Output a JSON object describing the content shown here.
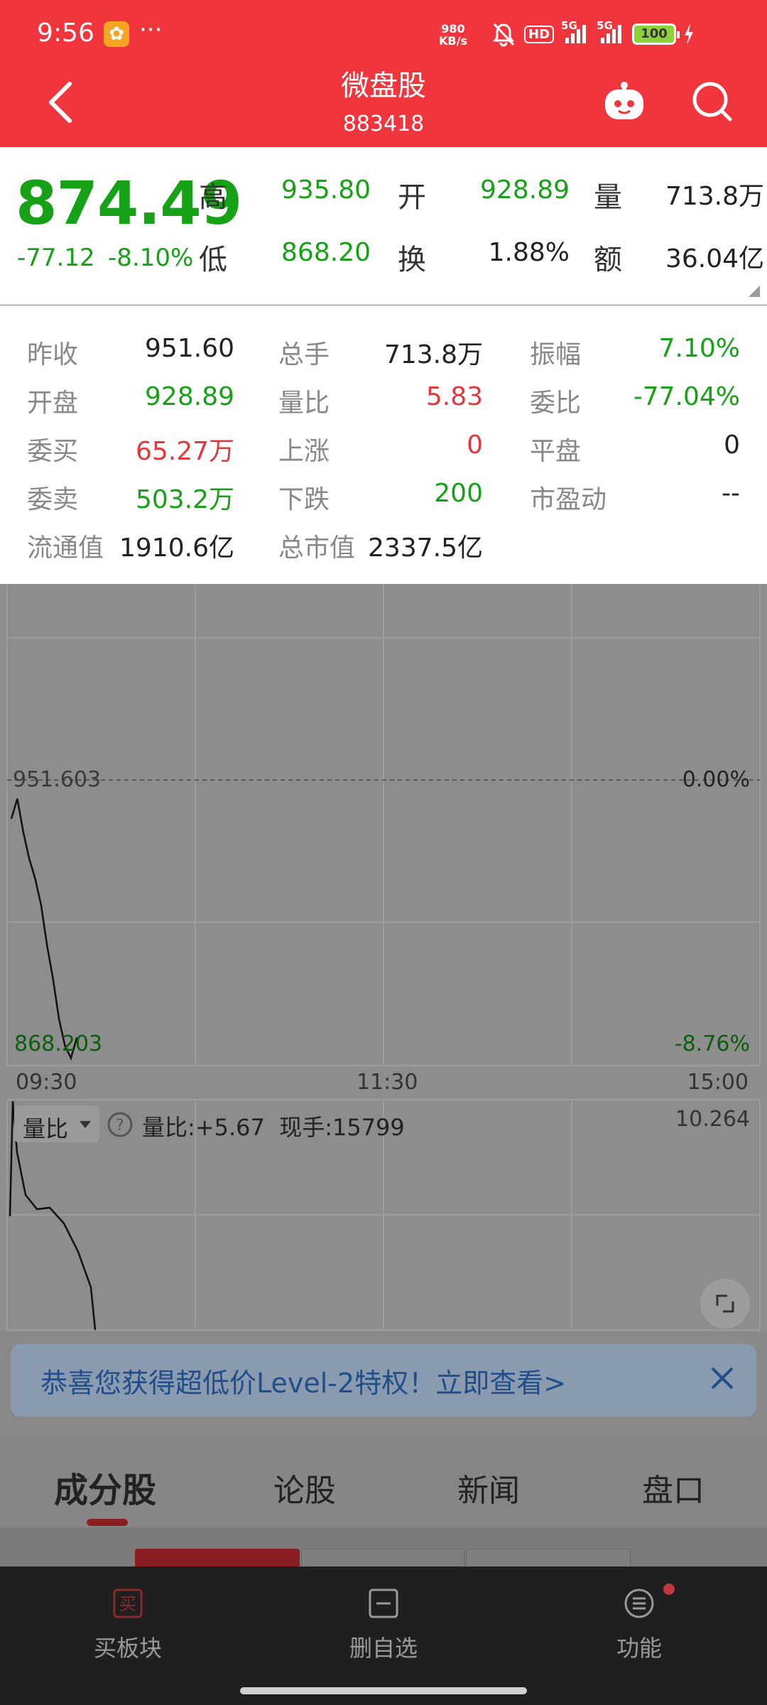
{
  "status_bar": {
    "time": "9:56",
    "dots": "···",
    "net_speed_value": "980",
    "net_speed_unit": "KB/s",
    "battery": "100",
    "network_1": "5G",
    "network_2": "5G"
  },
  "header": {
    "title": "微盘股",
    "code": "883418"
  },
  "quote": {
    "price": "874.49",
    "change": "-77.12",
    "change_pct": "-8.10%",
    "high_label": "高",
    "high": "935.80",
    "low_label": "低",
    "low": "868.20",
    "open_label": "开",
    "open": "928.89",
    "turnover_label": "换",
    "turnover": "1.88%",
    "volume_label": "量",
    "volume": "713.8万",
    "amount_label": "额",
    "amount": "36.04亿"
  },
  "stats": [
    [
      {
        "label": "昨收",
        "value": "951.60",
        "color": "dark"
      },
      {
        "label": "总手",
        "value": "713.8万",
        "color": "dark"
      },
      {
        "label": "振幅",
        "value": "7.10%",
        "color": "green"
      }
    ],
    [
      {
        "label": "开盘",
        "value": "928.89",
        "color": "green"
      },
      {
        "label": "量比",
        "value": "5.83",
        "color": "red"
      },
      {
        "label": "委比",
        "value": "-77.04%",
        "color": "green"
      }
    ],
    [
      {
        "label": "委买",
        "value": "65.27万",
        "color": "red"
      },
      {
        "label": "上涨",
        "value": "0",
        "color": "red"
      },
      {
        "label": "平盘",
        "value": "0",
        "color": "dark"
      }
    ],
    [
      {
        "label": "委卖",
        "value": "503.2万",
        "color": "green"
      },
      {
        "label": "下跌",
        "value": "200",
        "color": "green"
      },
      {
        "label": "市盈动",
        "value": "--",
        "color": "dark"
      }
    ],
    [
      {
        "label": "流通值",
        "value": "1910.6亿",
        "color": "dark"
      },
      {
        "label": "总市值",
        "value": "2337.5亿",
        "color": "dark"
      }
    ]
  ],
  "chart": {
    "prev_close_label": "951.603",
    "right_zero": "0.00%",
    "low_label": "868.203",
    "right_low": "-8.76%",
    "time_start": "09:30",
    "time_mid": "11:30",
    "time_end": "15:00",
    "vol_indicator": "量比",
    "vol_desc": "量比:+5.67  现手:15799",
    "vol_max": "10.264"
  },
  "chart_data": {
    "type": "line",
    "title": "",
    "x": [
      "09:30",
      "09:32",
      "09:34",
      "09:36",
      "09:38",
      "09:40",
      "09:42",
      "09:44",
      "09:46",
      "09:48",
      "09:50",
      "09:52"
    ],
    "series": [
      {
        "values": [
          940.0,
          946.0,
          936.0,
          928.0,
          922.0,
          914.0,
          902.0,
          892.0,
          880.0,
          872.0,
          868.3,
          874.5
        ]
      }
    ],
    "ylim": [
      868.2,
      951.6
    ],
    "prev_close": 951.603,
    "grid": true
  },
  "promo": {
    "text": "恭喜您获得超低价Level-2特权！立即查看>"
  },
  "tabs": [
    "成分股",
    "论股",
    "新闻",
    "盘口"
  ],
  "bottom_nav": [
    {
      "label": "买板块",
      "icon": "buy-icon"
    },
    {
      "label": "删自选",
      "icon": "minus-box-icon"
    },
    {
      "label": "功能",
      "icon": "menu-circle-icon"
    }
  ],
  "colors": {
    "header_red": "#f1353d",
    "up_red": "#e03a3e",
    "down_green": "#17a117"
  }
}
